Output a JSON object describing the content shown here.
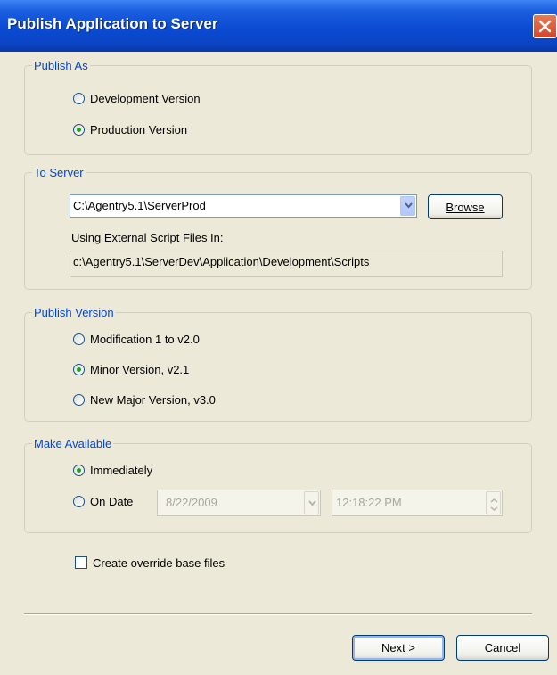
{
  "window": {
    "title": "Publish Application to Server"
  },
  "publish_as": {
    "legend": "Publish As",
    "options": [
      {
        "label": "Development Version",
        "checked": false
      },
      {
        "label": "Production Version",
        "checked": true
      }
    ]
  },
  "to_server": {
    "legend": "To Server",
    "server_value": "C:\\Agentry5.1\\ServerProd",
    "browse_label": "Browse",
    "scripts_label": "Using External Script Files In:",
    "scripts_path": "c:\\Agentry5.1\\ServerDev\\Application\\Development\\Scripts"
  },
  "publish_version": {
    "legend": "Publish Version",
    "options": [
      {
        "label": "Modification 1 to v2.0",
        "checked": false
      },
      {
        "label": "Minor Version, v2.1",
        "checked": true
      },
      {
        "label": "New Major Version, v3.0",
        "checked": false
      }
    ]
  },
  "make_available": {
    "legend": "Make Available",
    "immediately_label": "Immediately",
    "immediately_checked": true,
    "on_date_label": "On Date",
    "on_date_checked": false,
    "date_value": "8/22/2009",
    "time_value": "12:18:22 PM"
  },
  "override": {
    "label": "Create override base files",
    "checked": false
  },
  "buttons": {
    "next": "Next >",
    "cancel": "Cancel"
  }
}
